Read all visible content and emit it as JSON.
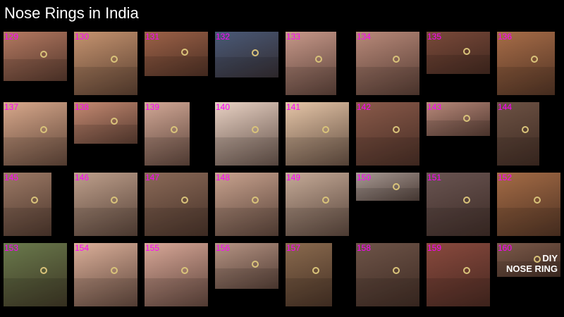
{
  "page": {
    "title": "Nose Rings in India"
  },
  "accent_color": "#ff00ff",
  "tiles": [
    {
      "number": "129",
      "color": "#b57a62"
    },
    {
      "number": "130",
      "color": "#c69470"
    },
    {
      "number": "131",
      "color": "#9d6248"
    },
    {
      "number": "132",
      "color": "#4a5a78"
    },
    {
      "number": "133",
      "color": "#c8998a"
    },
    {
      "number": "134",
      "color": "#b98a7a"
    },
    {
      "number": "135",
      "color": "#7a4a3a"
    },
    {
      "number": "136",
      "color": "#a86d48"
    },
    {
      "number": "137",
      "color": "#d9a98c"
    },
    {
      "number": "138",
      "color": "#c58a72"
    },
    {
      "number": "139",
      "color": "#d2a896"
    },
    {
      "number": "140",
      "color": "#e9d2c4"
    },
    {
      "number": "141",
      "color": "#e6c6a8"
    },
    {
      "number": "142",
      "color": "#8a5a4a"
    },
    {
      "number": "143",
      "color": "#b8897a"
    },
    {
      "number": "144",
      "color": "#6d5244"
    },
    {
      "number": "145",
      "color": "#9d7a66"
    },
    {
      "number": "146",
      "color": "#bfa08c"
    },
    {
      "number": "147",
      "color": "#8b6a58"
    },
    {
      "number": "148",
      "color": "#c9a38f"
    },
    {
      "number": "149",
      "color": "#c6ab98"
    },
    {
      "number": "150",
      "color": "#a89a94"
    },
    {
      "number": "151",
      "color": "#6a5552"
    },
    {
      "number": "152",
      "color": "#a56c46"
    },
    {
      "number": "153",
      "color": "#6a7a4c"
    },
    {
      "number": "154",
      "color": "#dcb09a"
    },
    {
      "number": "155",
      "color": "#d9a898"
    },
    {
      "number": "156",
      "color": "#b69484"
    },
    {
      "number": "157",
      "color": "#8a6a4e"
    },
    {
      "number": "158",
      "color": "#6e5448"
    },
    {
      "number": "159",
      "color": "#8a4a3e"
    },
    {
      "number": "160",
      "color": "#7c5a4a",
      "caption": "DIY\nNOSE RING"
    }
  ]
}
